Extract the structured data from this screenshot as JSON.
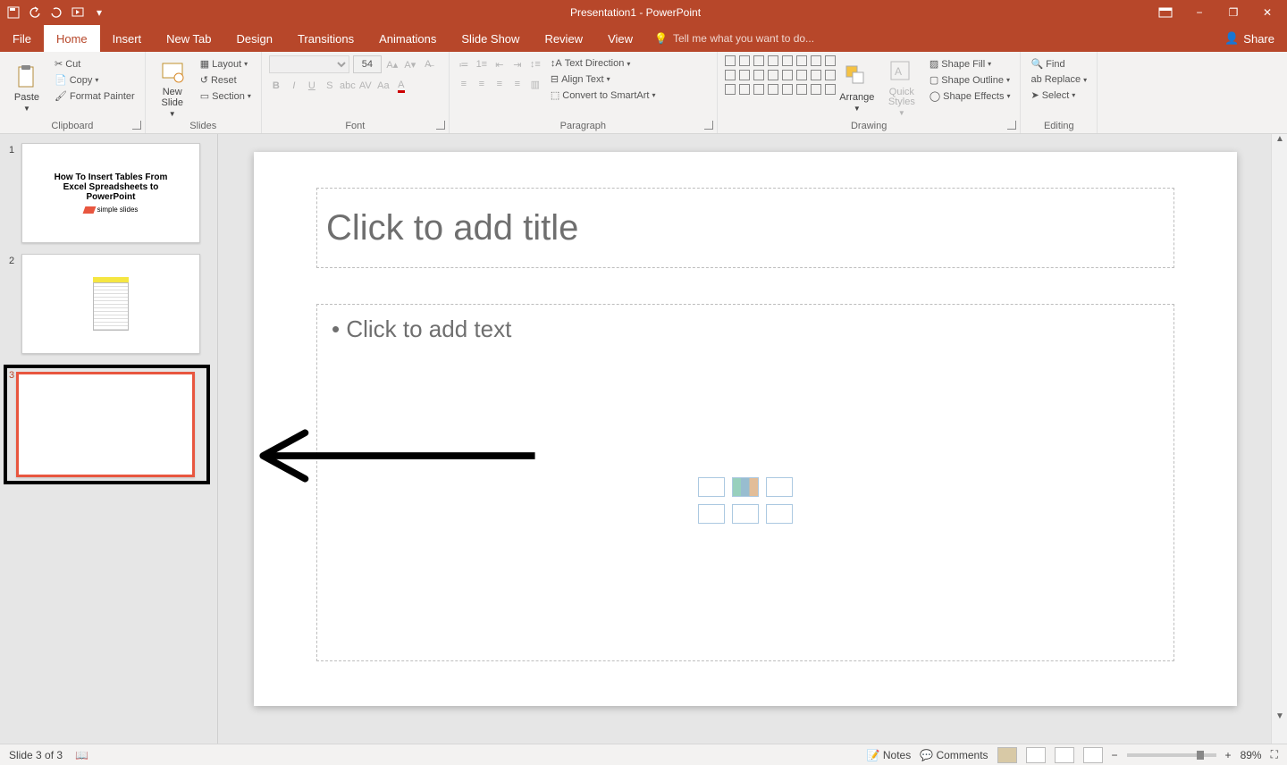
{
  "app": {
    "title": "Presentation1 - PowerPoint"
  },
  "qat": {
    "save": "save-icon",
    "undo": "undo-icon",
    "redo": "redo-icon",
    "startfrombeginning": "play-icon"
  },
  "window": {
    "ribbon_opts": "ribbon-display-options",
    "min": "−",
    "max": "❐",
    "close": "✕"
  },
  "tabs": [
    "File",
    "Home",
    "Insert",
    "New Tab",
    "Design",
    "Transitions",
    "Animations",
    "Slide Show",
    "Review",
    "View"
  ],
  "active_tab": "Home",
  "tellme": {
    "placeholder": "Tell me what you want to do..."
  },
  "share": "Share",
  "ribbon": {
    "clipboard": {
      "paste": "Paste",
      "cut": "Cut",
      "copy": "Copy",
      "format_painter": "Format Painter",
      "label": "Clipboard"
    },
    "slides": {
      "new_slide": "New Slide",
      "layout": "Layout",
      "reset": "Reset",
      "section": "Section",
      "label": "Slides"
    },
    "font": {
      "size": "54",
      "label": "Font"
    },
    "paragraph": {
      "text_direction": "Text Direction",
      "align_text": "Align Text",
      "convert": "Convert to SmartArt",
      "label": "Paragraph"
    },
    "drawing": {
      "arrange": "Arrange",
      "quick_styles": "Quick Styles",
      "shape_fill": "Shape Fill",
      "shape_outline": "Shape Outline",
      "shape_effects": "Shape Effects",
      "label": "Drawing"
    },
    "editing": {
      "find": "Find",
      "replace": "Replace",
      "select": "Select",
      "label": "Editing"
    }
  },
  "thumbs": {
    "items": [
      {
        "num": "1",
        "title1": "How To Insert Tables From",
        "title2": "Excel Spreadsheets to",
        "title3": "PowerPoint",
        "logo": "simple slides"
      },
      {
        "num": "2"
      },
      {
        "num": "3"
      }
    ],
    "selected": 2
  },
  "canvas": {
    "title_placeholder": "Click to add title",
    "body_placeholder": "• Click to add text"
  },
  "status": {
    "slide": "Slide 3 of 3",
    "notes": "Notes",
    "comments": "Comments",
    "zoom": "89%"
  }
}
